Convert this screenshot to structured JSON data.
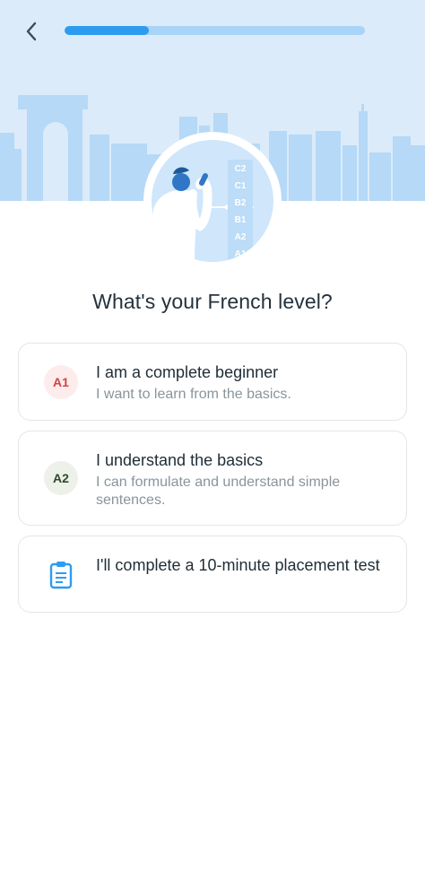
{
  "header": {
    "back_icon": "chevron-left-icon",
    "progress": 0.28
  },
  "illustration": {
    "levels": [
      "C2",
      "C1",
      "B2",
      "B1",
      "A2",
      "A1"
    ]
  },
  "main": {
    "title": "What's your French level?",
    "options": [
      {
        "badge": "A1",
        "title": "I am a complete beginner",
        "subtitle": "I want to learn from the basics.",
        "badge_bg": "#fdecec",
        "badge_color": "#d04545"
      },
      {
        "badge": "A2",
        "title": "I understand the basics",
        "subtitle": "I can formulate and understand simple sentences.",
        "badge_bg": "#eef1ea",
        "badge_color": "#2e4a2a"
      },
      {
        "icon": "clipboard-icon",
        "title": "I'll complete a 10-minute placement test",
        "icon_color": "#2d9cf0"
      }
    ]
  },
  "colors": {
    "accent": "#2d9cf0",
    "hero_bg": "#dcebfa",
    "skyline": "#b5d9f6"
  }
}
